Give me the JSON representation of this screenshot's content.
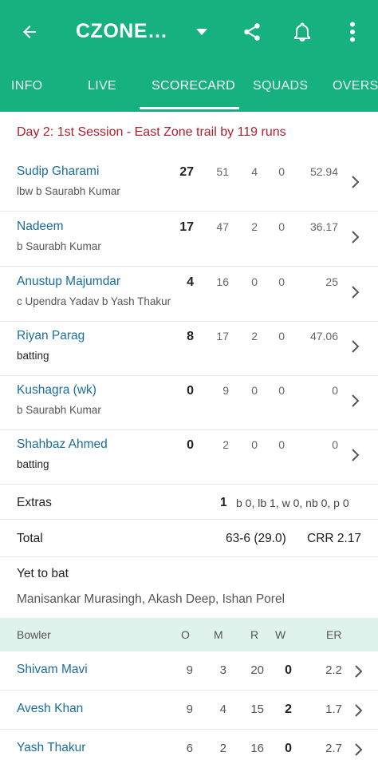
{
  "app_bar": {
    "title": "CZONE…",
    "tabs": [
      "INFO",
      "LIVE",
      "SCORECARD",
      "SQUADS",
      "OVERS"
    ],
    "active_tab": "SCORECARD",
    "accent_color": "#17b07f"
  },
  "status": "Day 2: 1st Session - East Zone trail by 119 runs",
  "batting": [
    {
      "name": "Sudip Gharami",
      "dismissal": "lbw b Saurabh Kumar",
      "runs": "27",
      "balls": "51",
      "fours": "4",
      "sixes": "0",
      "sr": "52.94"
    },
    {
      "name": "Nadeem",
      "dismissal": "b Saurabh Kumar",
      "runs": "17",
      "balls": "47",
      "fours": "2",
      "sixes": "0",
      "sr": "36.17"
    },
    {
      "name": "Anustup Majumdar",
      "dismissal": "c Upendra Yadav b Yash Thakur",
      "runs": "4",
      "balls": "16",
      "fours": "0",
      "sixes": "0",
      "sr": "25"
    },
    {
      "name": "Riyan Parag",
      "dismissal": "batting",
      "runs": "8",
      "balls": "17",
      "fours": "2",
      "sixes": "0",
      "sr": "47.06"
    },
    {
      "name": "Kushagra (wk)",
      "dismissal": "b Saurabh Kumar",
      "runs": "0",
      "balls": "9",
      "fours": "0",
      "sixes": "0",
      "sr": "0"
    },
    {
      "name": "Shahbaz Ahmed",
      "dismissal": "batting",
      "runs": "0",
      "balls": "2",
      "fours": "0",
      "sixes": "0",
      "sr": "0"
    }
  ],
  "extras": {
    "label": "Extras",
    "total": "1",
    "detail": "b 0, lb 1, w 0, nb 0, p 0"
  },
  "total": {
    "label": "Total",
    "score": "63-6 (29.0)",
    "crr": "CRR 2.17"
  },
  "yet_to_bat": {
    "label": "Yet to bat",
    "players": "Manisankar Murasingh, Akash Deep, Ishan Porel"
  },
  "bowling_header": {
    "bowler": "Bowler",
    "o": "O",
    "m": "M",
    "r": "R",
    "w": "W",
    "er": "ER"
  },
  "bowling": [
    {
      "name": "Shivam Mavi",
      "o": "9",
      "m": "3",
      "r": "20",
      "w": "0",
      "er": "2.2"
    },
    {
      "name": "Avesh Khan",
      "o": "9",
      "m": "4",
      "r": "15",
      "w": "2",
      "er": "1.7"
    },
    {
      "name": "Yash Thakur",
      "o": "6",
      "m": "2",
      "r": "16",
      "w": "0",
      "er": "2.7"
    }
  ]
}
